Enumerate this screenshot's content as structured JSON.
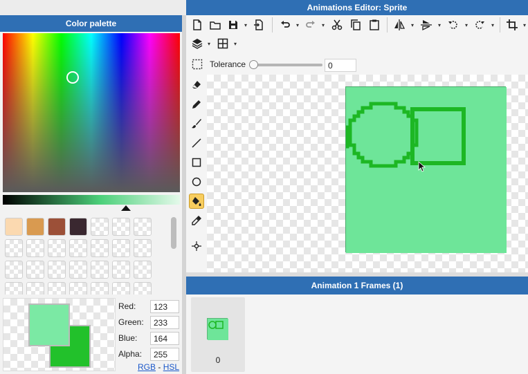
{
  "window": {
    "title": "Animations Editor: Sprite"
  },
  "palette": {
    "title": "Color palette",
    "swatches": [
      "#fbd9b0",
      "#d99a50",
      "#9c5038",
      "#3a2830"
    ],
    "preview": {
      "primary": "#7be9a4",
      "secondary": "#22c12b"
    },
    "fields": [
      {
        "label": "Red:",
        "value": "123"
      },
      {
        "label": "Green:",
        "value": "233"
      },
      {
        "label": "Blue:",
        "value": "164"
      },
      {
        "label": "Alpha:",
        "value": "255"
      }
    ],
    "modes": {
      "rgb": "RGB",
      "sep": "-",
      "hsl": "HSL"
    }
  },
  "toolbar": {
    "tolerance_label": "Tolerance",
    "tolerance_value": "0",
    "tolerance_level": 0,
    "icons": [
      "new-file-icon",
      "open-folder-icon",
      "save-icon",
      "export-icon",
      "undo-icon",
      "redo-icon",
      "cut-icon",
      "copy-icon",
      "paste-icon",
      "flip-horizontal-icon",
      "flip-vertical-icon",
      "rotate-left-icon",
      "rotate-right-icon",
      "crop-icon",
      "layers-icon",
      "grid-icon",
      "selection-icon"
    ]
  },
  "tools": [
    "eraser-icon",
    "pencil-icon",
    "brush-icon",
    "line-icon",
    "rectangle-icon",
    "ellipse-icon",
    "fill-bucket-icon",
    "eyedropper-icon",
    "anchor-icon"
  ],
  "colors": {
    "accent": "#2f6fb4",
    "canvas_fill": "#6ee599",
    "stroke": "#1db724",
    "active_tool": "#f8cd5e"
  },
  "frames": {
    "title": "Animation 1 Frames (1)",
    "items": [
      {
        "label": "0"
      }
    ]
  }
}
